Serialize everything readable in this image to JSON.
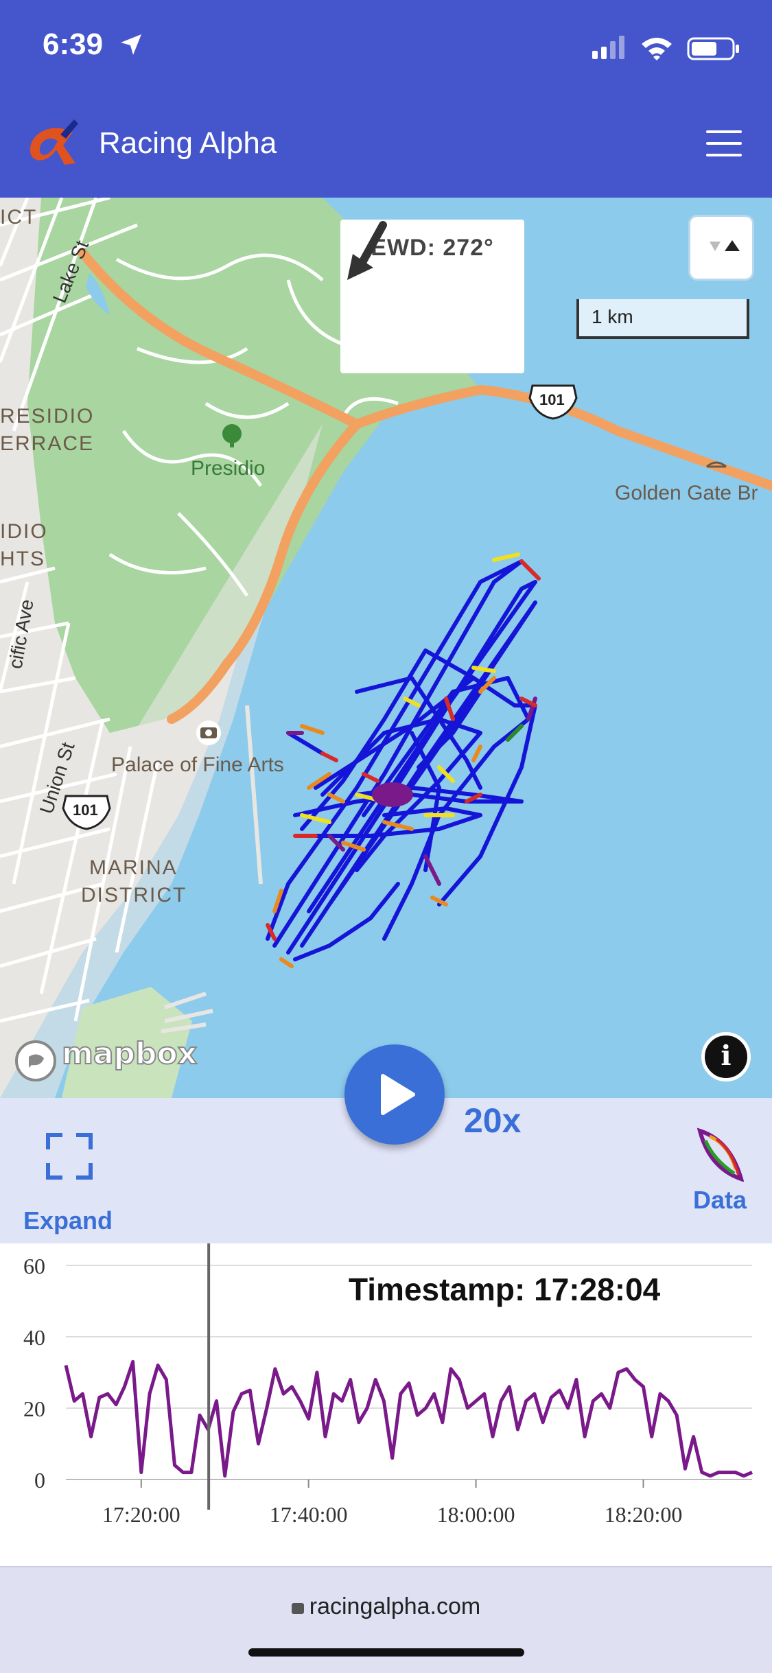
{
  "status": {
    "time": "6:39"
  },
  "header": {
    "title": "Racing Alpha"
  },
  "map": {
    "labels": {
      "lake_st": "Lake St",
      "presidio_terrace_1": "RESIDIO",
      "presidio_terrace_2": "ERRACE",
      "presidio_heights_1": "IDIO",
      "presidio_heights_2": "HTS",
      "presidio": "Presidio",
      "golden_gate": "Golden Gate Br",
      "palace": "Palace of Fine Arts",
      "union_st": "Union St",
      "marina_1": "MARINA",
      "marina_2": "DISTRICT",
      "pacific_ave": "cific Ave",
      "district_top": "ICT",
      "hwy_101_a": "101",
      "hwy_101_b": "101"
    },
    "wind": {
      "label": "EWD: 272°"
    },
    "scale": "1 km",
    "attribution": "mapbox"
  },
  "controls": {
    "speed": "20x",
    "expand_label": "Expand",
    "data_label": "Data"
  },
  "chart_data": {
    "type": "line",
    "title": "Timestamp: 17:28:04",
    "x_ticks": [
      "17:20:00",
      "17:40:00",
      "18:00:00",
      "18:20:00"
    ],
    "y_ticks": [
      "0",
      "20",
      "40",
      "60"
    ],
    "ylim": [
      0,
      60
    ],
    "xlim": [
      "17:11:00",
      "18:33:00"
    ],
    "cursor_x": "17:28:04",
    "series": [
      {
        "color": "#7a1a8a",
        "x": [
          "17:11",
          "17:12",
          "17:13",
          "17:14",
          "17:15",
          "17:16",
          "17:17",
          "17:18",
          "17:19",
          "17:20",
          "17:21",
          "17:22",
          "17:23",
          "17:24",
          "17:25",
          "17:26",
          "17:27",
          "17:28",
          "17:29",
          "17:30",
          "17:31",
          "17:32",
          "17:33",
          "17:34",
          "17:35",
          "17:36",
          "17:37",
          "17:38",
          "17:39",
          "17:40",
          "17:41",
          "17:42",
          "17:43",
          "17:44",
          "17:45",
          "17:46",
          "17:47",
          "17:48",
          "17:49",
          "17:50",
          "17:51",
          "17:52",
          "17:53",
          "17:54",
          "17:55",
          "17:56",
          "17:57",
          "17:58",
          "17:59",
          "18:00",
          "18:01",
          "18:02",
          "18:03",
          "18:04",
          "18:05",
          "18:06",
          "18:07",
          "18:08",
          "18:09",
          "18:10",
          "18:11",
          "18:12",
          "18:13",
          "18:14",
          "18:15",
          "18:16",
          "18:17",
          "18:18",
          "18:19",
          "18:20",
          "18:21",
          "18:22",
          "18:23",
          "18:24",
          "18:25",
          "18:26",
          "18:27",
          "18:28",
          "18:29",
          "18:30",
          "18:31",
          "18:32",
          "18:33"
        ],
        "values": [
          32,
          22,
          24,
          12,
          23,
          24,
          21,
          26,
          33,
          2,
          24,
          32,
          28,
          4,
          2,
          2,
          18,
          14,
          22,
          1,
          19,
          24,
          25,
          10,
          20,
          31,
          24,
          26,
          22,
          17,
          30,
          12,
          24,
          22,
          28,
          16,
          20,
          28,
          22,
          6,
          24,
          27,
          18,
          20,
          24,
          16,
          31,
          28,
          20,
          22,
          24,
          12,
          22,
          26,
          14,
          22,
          24,
          16,
          23,
          25,
          20,
          28,
          12,
          22,
          24,
          20,
          30,
          31,
          28,
          26,
          12,
          24,
          22,
          18,
          3,
          12,
          2,
          1,
          2,
          2,
          2,
          1,
          2
        ]
      }
    ]
  }
}
